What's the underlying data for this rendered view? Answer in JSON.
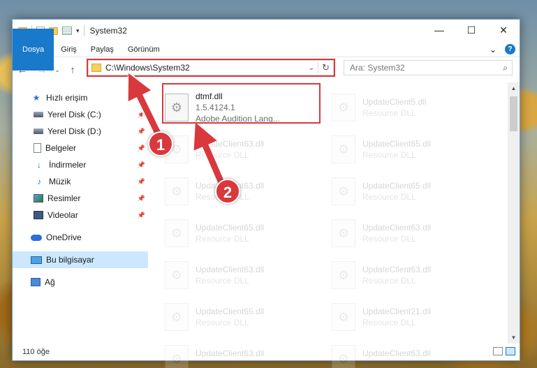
{
  "window": {
    "title": "System32",
    "min": "—",
    "max": "☐",
    "close": "✕"
  },
  "ribbon": {
    "tabs": [
      "Dosya",
      "Giriş",
      "Paylaş",
      "Görünüm"
    ],
    "expand": "⌄",
    "help": "?"
  },
  "nav": {
    "back": "←",
    "forward": "→",
    "recent": "⌄",
    "up": "↑"
  },
  "address": {
    "path": "C:\\Windows\\System32",
    "dropdown": "⌄",
    "refresh": "↻"
  },
  "search": {
    "placeholder": "Ara: System32"
  },
  "sidebar": {
    "quick_access": "Hızlı erişim",
    "items": [
      {
        "label": "Yerel Disk (C:)",
        "icon": "drive-icon",
        "pinned": true
      },
      {
        "label": "Yerel Disk (D:)",
        "icon": "drive-icon",
        "pinned": true
      },
      {
        "label": "Belgeler",
        "icon": "documents-icon",
        "pinned": true
      },
      {
        "label": "İndirmeler",
        "icon": "downloads-icon",
        "pinned": true
      },
      {
        "label": "Müzik",
        "icon": "music-icon",
        "pinned": true
      },
      {
        "label": "Resimler",
        "icon": "pictures-icon",
        "pinned": true
      },
      {
        "label": "Videolar",
        "icon": "videos-icon",
        "pinned": true
      }
    ],
    "onedrive": "OneDrive",
    "this_pc": "Bu bilgisayar",
    "network": "Ağ"
  },
  "files": [
    {
      "name": "dtmf.dll",
      "line2": "1.5.4124.1",
      "line3": "Adobe Audition Lang...",
      "highlighted": true
    },
    {
      "name": "UpdateClient5.dll",
      "line2": "Resource DLL",
      "line3": ""
    },
    {
      "name": "UpdateClient63.dll",
      "line2": "Resource DLL",
      "line3": ""
    },
    {
      "name": "UpdateClient65.dll",
      "line2": "Resource DLL",
      "line3": ""
    },
    {
      "name": "UpdateClient63.dll",
      "line2": "Resource DLL",
      "line3": ""
    },
    {
      "name": "UpdateClient65.dll",
      "line2": "Resource DLL",
      "line3": ""
    },
    {
      "name": "UpdateClient65.dll",
      "line2": "Resource DLL",
      "line3": ""
    },
    {
      "name": "UpdateClient63.dll",
      "line2": "Resource DLL",
      "line3": ""
    },
    {
      "name": "UpdateClient63.dll",
      "line2": "Resource DLL",
      "line3": ""
    },
    {
      "name": "UpdateClient63.dll",
      "line2": "Resource DLL",
      "line3": ""
    },
    {
      "name": "UpdateClient65.dll",
      "line2": "Resource DLL",
      "line3": ""
    },
    {
      "name": "UpdateClient21.dll",
      "line2": "Resource DLL",
      "line3": ""
    },
    {
      "name": "UpdateClient63.dll",
      "line2": "Resource DLL",
      "line3": ""
    },
    {
      "name": "UpdateClient63.dll",
      "line2": "Resource DLL",
      "line3": ""
    }
  ],
  "status": {
    "count": "110 öğe"
  },
  "callouts": {
    "one": "1",
    "two": "2"
  },
  "colors": {
    "accent": "#1979ca",
    "highlight": "#d9383c",
    "selected_bg": "#cce8ff"
  }
}
